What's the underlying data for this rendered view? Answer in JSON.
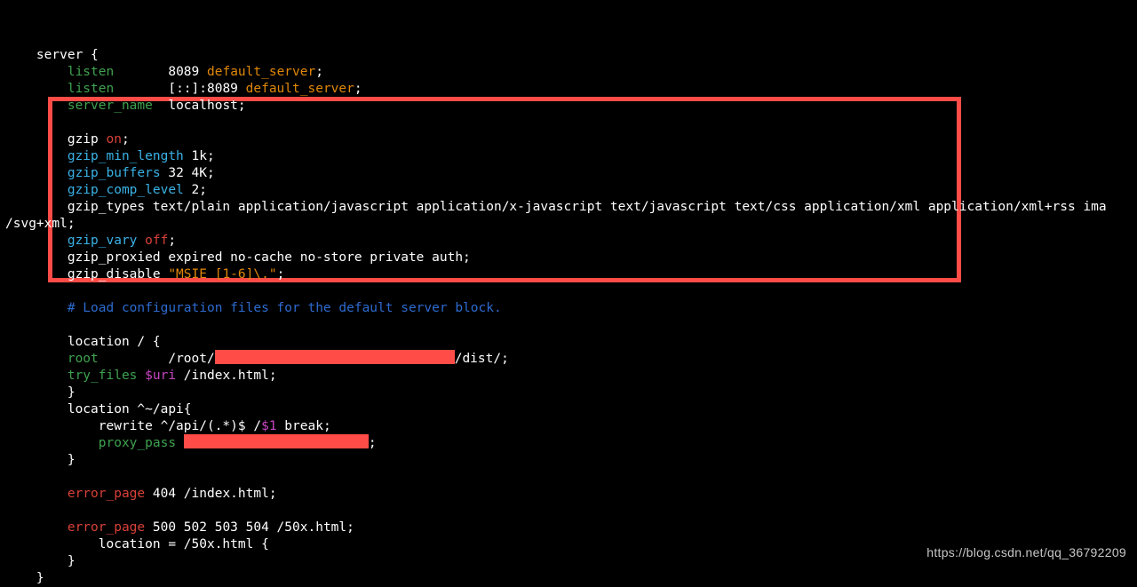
{
  "srv_open": "    server {",
  "l1a": "        ",
  "l1_listen": "listen",
  "l1b": "       8089 ",
  "l1_ds": "default_server",
  "l1c": ";",
  "l2a": "        ",
  "l2_listen": "listen",
  "l2b": "       [::]:8089 ",
  "l2_ds": "default_server",
  "l2c": ";",
  "l3a": "        ",
  "l3_sn": "server_name",
  "l3b": "  localhost;",
  "g1a": "        gzip ",
  "g1_on": "on",
  "g1b": ";",
  "g2a": "        ",
  "g2_key": "gzip_min_length",
  "g2b": " 1k;",
  "g3a": "        ",
  "g3_key": "gzip_buffers",
  "g3b": " 32 4K;",
  "g4a": "        ",
  "g4_key": "gzip_comp_level",
  "g4b": " 2;",
  "g5": "        gzip_types text/plain application/javascript application/x-javascript text/javascript text/css application/xml application/xml+rss ima",
  "g5b": "/svg+xml;",
  "g6a": "        ",
  "g6_key": "gzip_vary",
  "g6b": " ",
  "g6_off": "off",
  "g6c": ";",
  "g7": "        gzip_proxied expired no-cache no-store private auth;",
  "g8a": "        gzip_disable ",
  "g8_str": "\"MSIE",
  "g8_sp": " ",
  "g8_str2": "[1-6]\\.\"",
  "g8b": ";",
  "cmt_a": "        ",
  "cmt": "# Load configuration files for the default server block.",
  "loc1": "        location / {",
  "rt_a": "        ",
  "rt_root": "root",
  "rt_b": "         /root/",
  "rt_c": "/dist/;",
  "tf_a": "        ",
  "tf_key": "try_files",
  "tf_b": " ",
  "tf_var": "$uri",
  "tf_c": " /index.html;",
  "loc1_close": "        }",
  "loc2": "        location ^~/api{",
  "rw_a": "            rewrite ^/api/(.*)$ /",
  "rw_var": "$1",
  "rw_b": " break;",
  "pp_a": "            ",
  "pp_key": "proxy_pass",
  "pp_b": " ",
  "pp_c": ";",
  "loc2_close": "        }",
  "ep1_a": "        ",
  "ep1_key": "error_page",
  "ep1_b": " 404 /index.html;",
  "ep2_a": "        ",
  "ep2_key": "error_page",
  "ep2_b": " 500 502 503 504 /50x.html;",
  "loc3": "            location = /50x.html {",
  "loc3_close": "        }",
  "srv_close": "    }",
  "watermark": "https://blog.csdn.net/qq_36792209"
}
